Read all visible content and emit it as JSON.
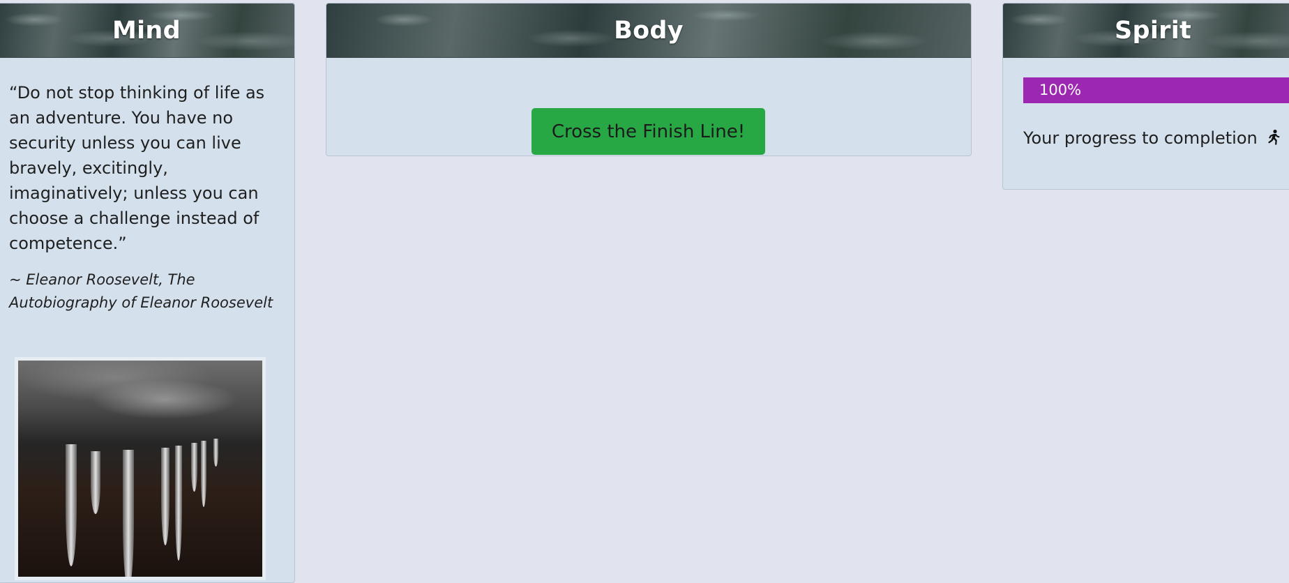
{
  "mind": {
    "title": "Mind",
    "quote": "“Do not stop thinking of life as an adventure. You have no security unless you can live bravely, excitingly, imaginatively; unless you can choose a challenge instead of competence.”",
    "attribution": "~ Eleanor Roosevelt, The Autobiography of Eleanor Roosevelt",
    "image_icon": "icicles-photo"
  },
  "body": {
    "title": "Body",
    "finish_button_label": "Cross the Finish Line!",
    "button_color": "#28a745"
  },
  "spirit": {
    "title": "Spirit",
    "progress_percent": 100,
    "progress_label": "100%",
    "progress_color": "#9c27b0",
    "caption": "Your progress to completion",
    "caption_icon": "runner-icon"
  }
}
